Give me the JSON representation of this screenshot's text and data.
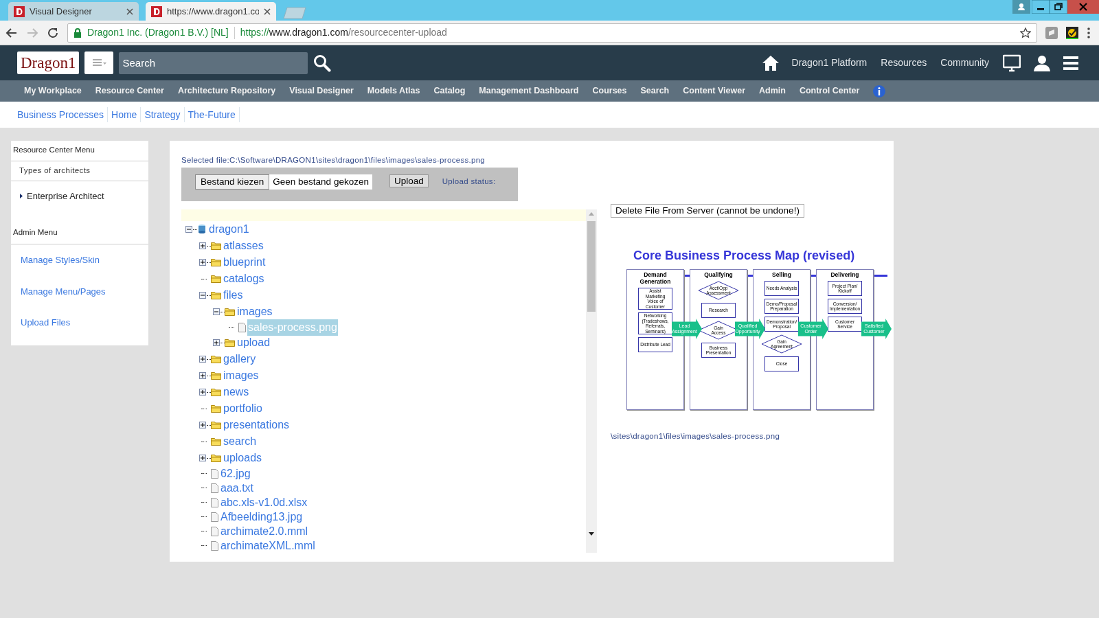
{
  "browser": {
    "tabs": [
      {
        "title": "Visual Designer",
        "selected": false
      },
      {
        "title": "https://www.dragon1.co",
        "selected": true
      }
    ],
    "address": {
      "identity": "Dragon1 Inc. (Dragon1 B.V.) [NL]",
      "scheme": "https://",
      "host": "www.dragon1.com",
      "path": "/resourcecenter-upload"
    }
  },
  "header": {
    "logo": "Dragon1",
    "search": {
      "placeholder": "Search"
    },
    "links": [
      "Dragon1 Platform",
      "Resources",
      "Community"
    ]
  },
  "nav": [
    "My Workplace",
    "Resource Center",
    "Architecture Repository",
    "Visual Designer",
    "Models Atlas",
    "Catalog",
    "Management Dashboard",
    "Courses",
    "Search",
    "Content Viewer",
    "Admin",
    "Control Center"
  ],
  "breadcrumbs": [
    "Business Processes",
    "Home",
    "Strategy",
    "The-Future"
  ],
  "sidebar": {
    "resource_menu": {
      "title": "Resource Center Menu",
      "subtitle": "Types of architects",
      "items": [
        "Enterprise Architect"
      ]
    },
    "admin_menu": {
      "title": "Admin Menu",
      "items": [
        "Manage Styles/Skin",
        "Manage Menu/Pages",
        "Upload Files"
      ]
    }
  },
  "upload": {
    "selected_file": "Selected file:C:\\Software\\DRAGON1\\sites\\dragon1\\files\\images\\sales-process.png",
    "choose_button": "Bestand kiezen",
    "file_status": "Geen bestand gekozen",
    "upload_button": "Upload",
    "upload_status": "Upload status:"
  },
  "tree": [
    {
      "label": "dragon1",
      "kind": "root",
      "expanded": true,
      "selected": false,
      "children": [
        {
          "label": "atlasses",
          "kind": "folder",
          "expanded": false,
          "selected": false
        },
        {
          "label": "blueprint",
          "kind": "folder",
          "expanded": false,
          "selected": false
        },
        {
          "label": "catalogs",
          "kind": "folder",
          "selected": false
        },
        {
          "label": "files",
          "kind": "folder",
          "expanded": true,
          "selected": false,
          "children": [
            {
              "label": "images",
              "kind": "folder",
              "expanded": true,
              "selected": false,
              "children": [
                {
                  "label": "sales-process.png",
                  "kind": "file",
                  "selected": true
                }
              ]
            },
            {
              "label": "upload",
              "kind": "folder",
              "expanded": false,
              "selected": false
            }
          ]
        },
        {
          "label": "gallery",
          "kind": "folder",
          "expanded": false,
          "selected": false
        },
        {
          "label": "images",
          "kind": "folder",
          "expanded": false,
          "selected": false
        },
        {
          "label": "news",
          "kind": "folder",
          "expanded": false,
          "selected": false
        },
        {
          "label": "portfolio",
          "kind": "folder",
          "selected": false
        },
        {
          "label": "presentations",
          "kind": "folder",
          "expanded": false,
          "selected": false
        },
        {
          "label": "search",
          "kind": "folder",
          "selected": false
        },
        {
          "label": "uploads",
          "kind": "folder",
          "expanded": false,
          "selected": false
        },
        {
          "label": "62.jpg",
          "kind": "file",
          "selected": false
        },
        {
          "label": "aaa.txt",
          "kind": "file",
          "selected": false
        },
        {
          "label": "abc.xls-v1.0d.xlsx",
          "kind": "file",
          "selected": false
        },
        {
          "label": "Afbeelding13.jpg",
          "kind": "file",
          "selected": false
        },
        {
          "label": "archimate2.0.mml",
          "kind": "file",
          "selected": false
        },
        {
          "label": "archimateXML.mml",
          "kind": "file",
          "selected": false
        }
      ]
    }
  ],
  "delete_button": "Delete File From Server (cannot be undone!)",
  "preview": {
    "title": "Core Business Process Map (revised)",
    "lanes": [
      {
        "title": "Demand Generation",
        "steps": [
          {
            "label": "Assist Marketing Voice of Customer",
            "kind": "box"
          },
          {
            "label": "Networking (Tradeshows, Referrals, Seminars)",
            "kind": "box"
          },
          {
            "label": "Distribute Lead",
            "kind": "box"
          }
        ]
      },
      {
        "title": "Qualifying",
        "steps": [
          {
            "label": "Acct/Opp Assessment",
            "kind": "diamond"
          },
          {
            "label": "Research",
            "kind": "box"
          },
          {
            "label": "Gain Access",
            "kind": "diamond"
          },
          {
            "label": "Business Presentation",
            "kind": "box"
          }
        ]
      },
      {
        "title": "Selling",
        "steps": [
          {
            "label": "Needs Analysis",
            "kind": "box"
          },
          {
            "label": "Demo/Proposal Preparation",
            "kind": "box"
          },
          {
            "label": "Demonstration/ Proposal",
            "kind": "box"
          },
          {
            "label": "Gain Agreement",
            "kind": "diamond"
          },
          {
            "label": "Close",
            "kind": "box"
          }
        ]
      },
      {
        "title": "Delivering",
        "steps": [
          {
            "label": "Project Plan/ Kickoff",
            "kind": "box"
          },
          {
            "label": "Conversion/ Implementation",
            "kind": "box"
          },
          {
            "label": "Customer Service",
            "kind": "box"
          }
        ]
      }
    ],
    "handoffs": [
      "Lead Assignment",
      "Qualified Opportunity",
      "Customer Order",
      "Satisfied Customer"
    ]
  },
  "preview_path": "\\sites\\dragon1\\files\\images\\sales-process.png"
}
